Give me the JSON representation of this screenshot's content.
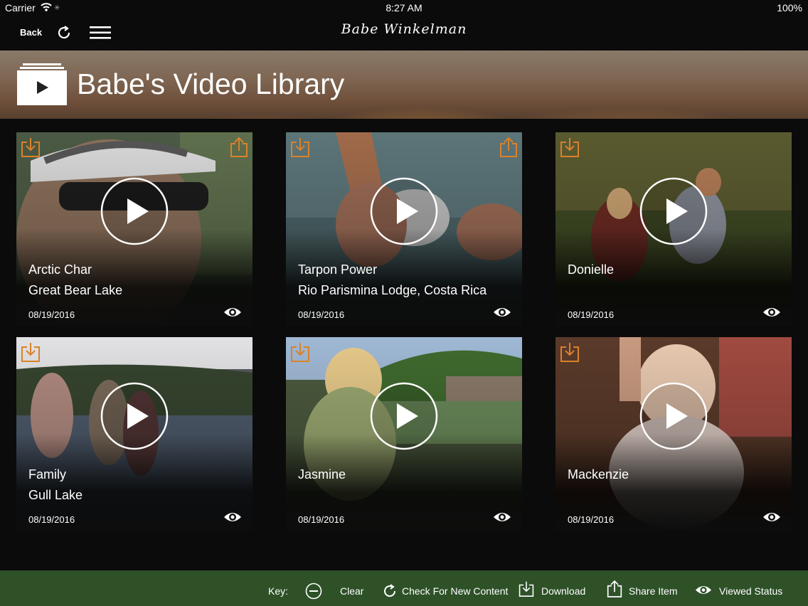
{
  "status": {
    "carrier": "Carrier",
    "time": "8:27 AM",
    "battery": "100%"
  },
  "nav": {
    "back_label": "Back",
    "brand": "Babe Winkelman"
  },
  "banner": {
    "title": "Babe's Video Library"
  },
  "videos": [
    {
      "title": "Arctic Char",
      "subtitle": "Great Bear Lake",
      "date": "08/19/2016",
      "has_share": true
    },
    {
      "title": "Tarpon Power",
      "subtitle": "Rio Parismina Lodge, Costa Rica",
      "date": "08/19/2016",
      "has_share": true
    },
    {
      "title": "Donielle",
      "subtitle": "",
      "date": "08/19/2016",
      "has_share": false
    },
    {
      "title": "Family",
      "subtitle": "Gull Lake",
      "date": "08/19/2016",
      "has_share": false
    },
    {
      "title": "Jasmine",
      "subtitle": "",
      "date": "08/19/2016",
      "has_share": false
    },
    {
      "title": "Mackenzie",
      "subtitle": "",
      "date": "08/19/2016",
      "has_share": false
    }
  ],
  "footer": {
    "key_label": "Key:",
    "clear_label": "Clear",
    "check_label": "Check For New Content",
    "download_label": "Download",
    "share_label": "Share Item",
    "viewed_label": "Viewed Status"
  },
  "colors": {
    "accent_orange": "#d9822b",
    "footer_green": "#2e5128",
    "background": "#0b0b0b"
  }
}
